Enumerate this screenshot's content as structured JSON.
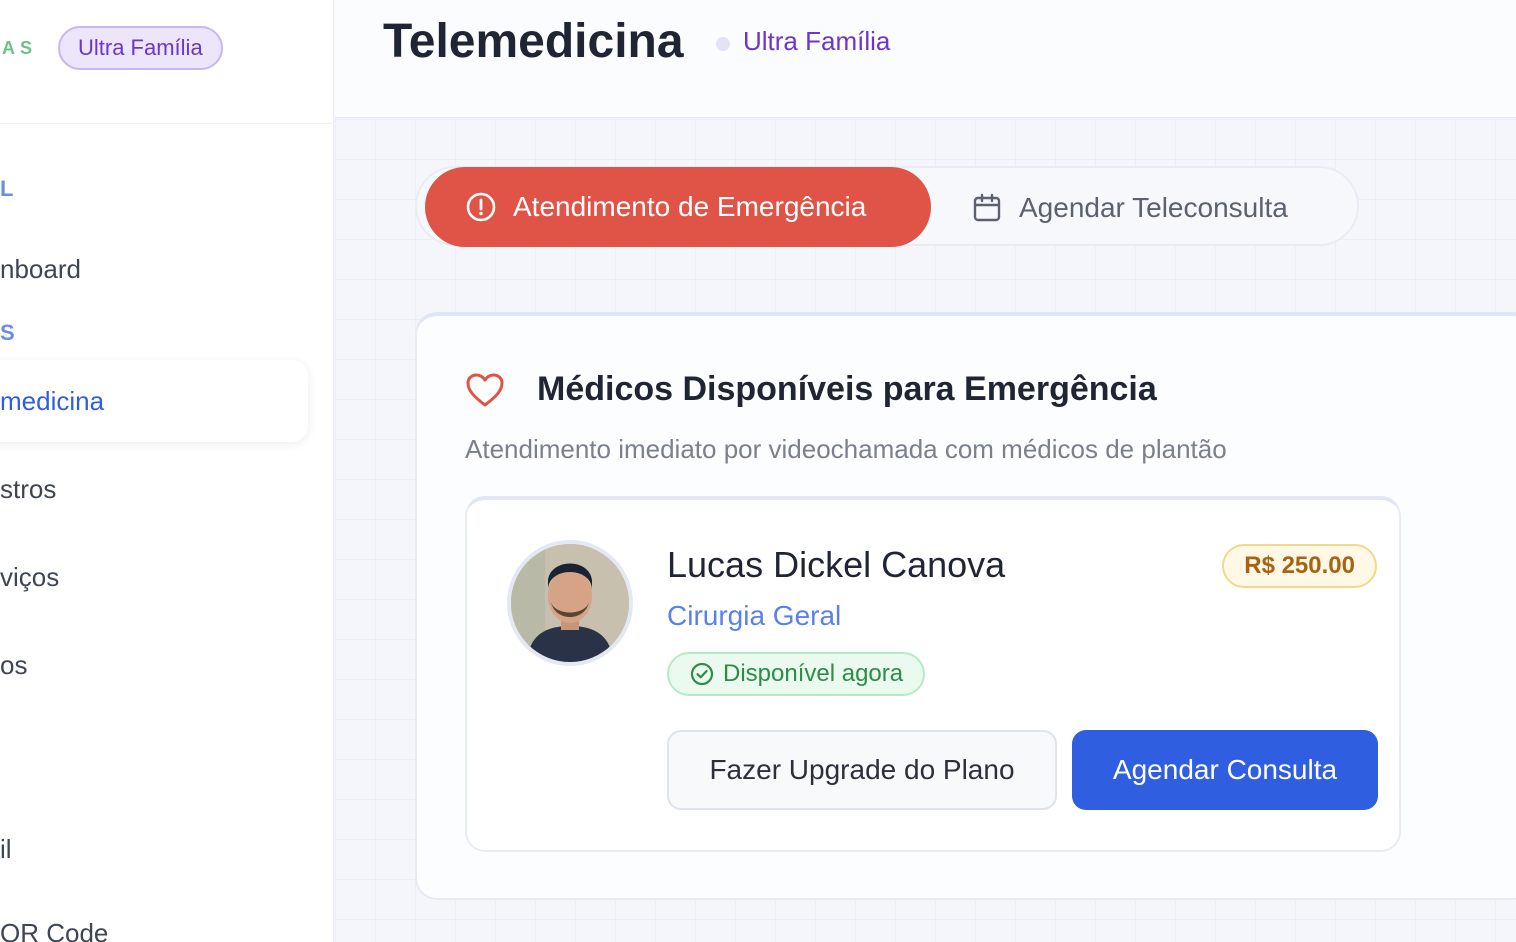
{
  "sidebar": {
    "brand_text": "AS",
    "plan_badge": "Ultra Família",
    "section_1": "L",
    "section_2": "S",
    "items": [
      {
        "label": "nboard"
      },
      {
        "label": "medicina"
      },
      {
        "label": "stros"
      },
      {
        "label": "viços"
      },
      {
        "label": "os"
      },
      {
        "label": "il"
      },
      {
        "label": "QR Code"
      }
    ]
  },
  "header": {
    "title": "Telemedicina",
    "plan": "Ultra Família"
  },
  "tabs": {
    "emergency": "Atendimento de Emergência",
    "schedule": "Agendar Teleconsulta"
  },
  "section": {
    "title": "Médicos Disponíveis para Emergência",
    "subtitle": "Atendimento imediato por videochamada com médicos de plantão"
  },
  "doctor": {
    "name": "Lucas Dickel Canova",
    "specialty": "Cirurgia Geral",
    "availability": "Disponível agora",
    "price": "R$ 250.00",
    "upgrade_label": "Fazer Upgrade do Plano",
    "book_label": "Agendar Consulta"
  },
  "colors": {
    "primary": "#2f5fe0",
    "emergency": "#df5447",
    "plan": "#6b36c9",
    "success": "#2f8b48"
  }
}
